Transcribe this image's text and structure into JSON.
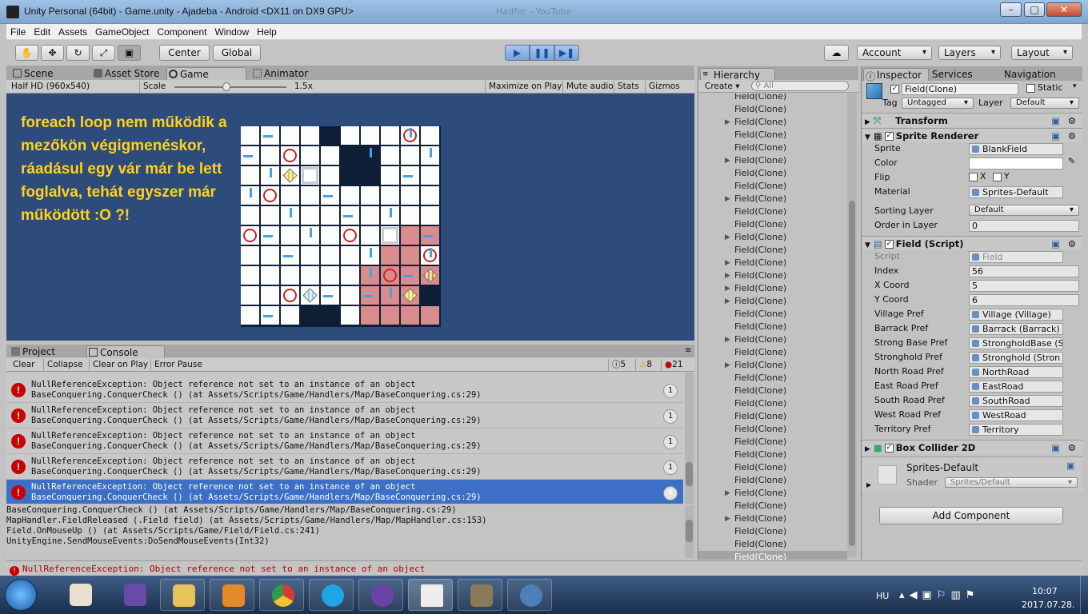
{
  "window": {
    "title": "Unity Personal (64bit) - Game.unity - Ajadeba - Android <DX11 on DX9 GPU>",
    "ghost_tab": "Hadfec - YouTube"
  },
  "menu": [
    "File",
    "Edit",
    "Assets",
    "GameObject",
    "Component",
    "Window",
    "Help"
  ],
  "toolbar": {
    "pivot": "Center",
    "space": "Global",
    "account": "Account",
    "layers": "Layers",
    "layout": "Layout"
  },
  "scene_tabs": {
    "scene": "Scene",
    "asset_store": "Asset Store",
    "game": "Game",
    "animator": "Animator"
  },
  "game_bar": {
    "resolution": "Half HD (960x540)",
    "scale_label": "Scale",
    "scale_value": "1.5x",
    "maximize": "Maximize on Play",
    "mute": "Mute audio",
    "stats": "Stats",
    "gizmos": "Gizmos"
  },
  "overlay_text": "foreach loop nem működik a mezőkön végigmenéskor, ráadásul egy vár már be lett foglalva, tehát egyszer már működött :O ?!",
  "bottom_tabs": {
    "project": "Project",
    "console": "Console"
  },
  "console_bar": {
    "clear": "Clear",
    "collapse": "Collapse",
    "clear_on_play": "Clear on Play",
    "error_pause": "Error Pause",
    "info_count": "5",
    "warn_count": "8",
    "error_count": "21"
  },
  "log_entries": [
    {
      "line1": "NullReferenceException: Object reference not set to an instance of an object",
      "line2": "BaseConquering.ConquerCheck () (at Assets/Scripts/Game/Handlers/Map/BaseConquering.cs:29)",
      "count": "1"
    },
    {
      "line1": "NullReferenceException: Object reference not set to an instance of an object",
      "line2": "BaseConquering.ConquerCheck () (at Assets/Scripts/Game/Handlers/Map/BaseConquering.cs:29)",
      "count": "1"
    },
    {
      "line1": "NullReferenceException: Object reference not set to an instance of an object",
      "line2": "BaseConquering.ConquerCheck () (at Assets/Scripts/Game/Handlers/Map/BaseConquering.cs:29)",
      "count": "1"
    },
    {
      "line1": "NullReferenceException: Object reference not set to an instance of an object",
      "line2": "BaseConquering.ConquerCheck () (at Assets/Scripts/Game/Handlers/Map/BaseConquering.cs:29)",
      "count": "1"
    },
    {
      "line1": "NullReferenceException: Object reference not set to an instance of an object",
      "line2": "BaseConquering.ConquerCheck () (at Assets/Scripts/Game/Handlers/Map/BaseConquering.cs:29)",
      "count": "4"
    }
  ],
  "stack_trace": [
    "BaseConquering.ConquerCheck () (at Assets/Scripts/Game/Handlers/Map/BaseConquering.cs:29)",
    "MapHandler.FieldReleased (.Field field) (at Assets/Scripts/Game/Handlers/Map/MapHandler.cs:153)",
    "Field.OnMouseUp () (at Assets/Scripts/Game/Field/Field.cs:241)",
    "UnityEngine.SendMouseEvents:DoSendMouseEvents(Int32)"
  ],
  "status_message": "NullReferenceException: Object reference not set to an instance of an object",
  "hierarchy": {
    "tab": "Hierarchy",
    "create": "Create",
    "search_placeholder": "All",
    "item_label": "Field(Clone)"
  },
  "inspector": {
    "tabs": {
      "inspector": "Inspector",
      "services": "Services",
      "navigation": "Navigation"
    },
    "object_name": "Field(Clone)",
    "static_label": "Static",
    "tag_label": "Tag",
    "tag_value": "Untagged",
    "layer_label": "Layer",
    "layer_value": "Default",
    "transform": "Transform",
    "sprite_renderer": {
      "title": "Sprite Renderer",
      "sprite_label": "Sprite",
      "sprite_value": "BlankField",
      "color_label": "Color",
      "flip_label": "Flip",
      "flip_x": "X",
      "flip_y": "Y",
      "material_label": "Material",
      "material_value": "Sprites-Default",
      "sorting_layer_label": "Sorting Layer",
      "sorting_layer_value": "Default",
      "order_label": "Order in Layer",
      "order_value": "0"
    },
    "field_script": {
      "title": "Field (Script)",
      "rows": [
        {
          "label": "Script",
          "value": "Field"
        },
        {
          "label": "Index",
          "value": "56"
        },
        {
          "label": "X Coord",
          "value": "5"
        },
        {
          "label": "Y Coord",
          "value": "6"
        },
        {
          "label": "Village Pref",
          "value": "Village (Village)"
        },
        {
          "label": "Barrack Pref",
          "value": "Barrack (Barrack)"
        },
        {
          "label": "Strong Base Pref",
          "value": "StrongholdBase (S"
        },
        {
          "label": "Stronghold Pref",
          "value": "Stronghold (Stron"
        },
        {
          "label": "North Road Pref",
          "value": "NorthRoad"
        },
        {
          "label": "East Road Pref",
          "value": "EastRoad"
        },
        {
          "label": "South Road Pref",
          "value": "SouthRoad"
        },
        {
          "label": "West Road Pref",
          "value": "WestRoad"
        },
        {
          "label": "Territory Pref",
          "value": "Territory"
        }
      ]
    },
    "box_collider": "Box Collider 2D",
    "material_preview": {
      "name": "Sprites-Default",
      "shader_label": "Shader",
      "shader_value": "Sprites/Default"
    },
    "add_component": "Add Component"
  },
  "tray": {
    "lang": "HU",
    "time": "10:07",
    "date": "2017.07.28."
  },
  "colors": {
    "game_bg": "#2d4b7b",
    "overlay_text": "#ffd21a",
    "territory": "#d98c8c",
    "road": "#3ba7e6",
    "selected_row": "#3c6fc5",
    "error": "#c80000"
  }
}
